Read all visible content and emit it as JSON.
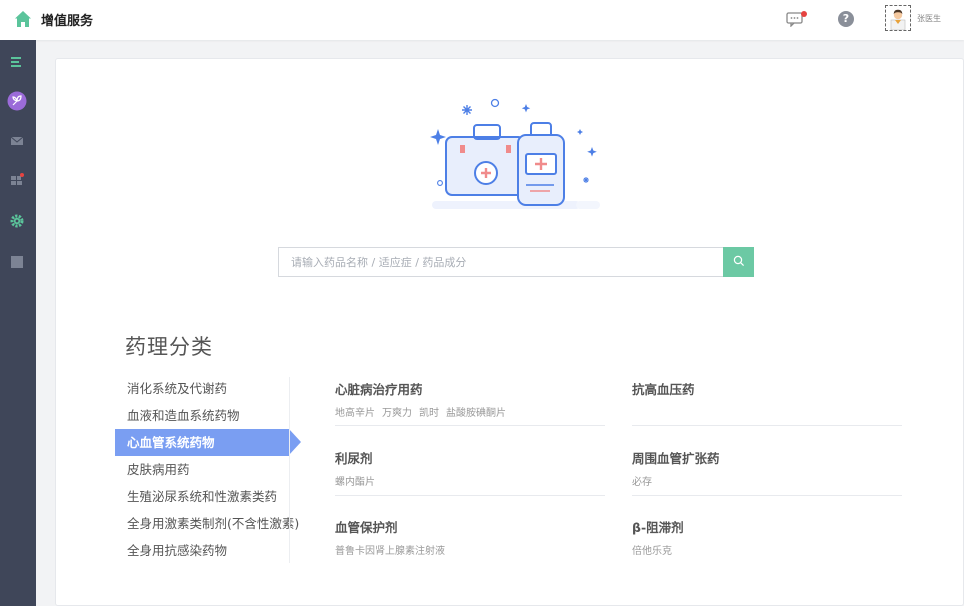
{
  "header": {
    "title": "增值服务",
    "username": "张医生"
  },
  "sidebar": {
    "items": [
      {
        "icon": "menu-icon"
      },
      {
        "icon": "leaf-icon"
      },
      {
        "icon": "mail-icon"
      },
      {
        "icon": "grid-icon"
      },
      {
        "icon": "gear-icon"
      },
      {
        "icon": "square-icon"
      }
    ]
  },
  "search": {
    "placeholder": "请输入药品名称 / 适应症 / 药品成分"
  },
  "section": {
    "title": "药理分类"
  },
  "categories": [
    {
      "label": "消化系统及代谢药"
    },
    {
      "label": "血液和造血系统药物"
    },
    {
      "label": "心血管系统药物",
      "active": true
    },
    {
      "label": "皮肤病用药"
    },
    {
      "label": "生殖泌尿系统和性激素类药"
    },
    {
      "label": "全身用激素类制剂(不含性激素)"
    },
    {
      "label": "全身用抗感染药物"
    }
  ],
  "subcategories": [
    {
      "title": "心脏病治疗用药",
      "drugs": [
        "地高辛片",
        "万爽力",
        "凯时",
        "盐酸胺碘酮片"
      ]
    },
    {
      "title": "抗高血压药",
      "drugs": []
    },
    {
      "title": "利尿剂",
      "drugs": [
        "螺内酯片"
      ]
    },
    {
      "title": "周围血管扩张药",
      "drugs": [
        "必存"
      ]
    },
    {
      "title": "血管保护剂",
      "drugs": [
        "普鲁卡因肾上腺素注射液"
      ]
    },
    {
      "title": "β-阻滞剂",
      "drugs": [
        "倍他乐克"
      ]
    }
  ],
  "colors": {
    "accent": "#6cc9a4",
    "active_category": "#7a9ef2",
    "sidebar_bg": "#3f4659"
  }
}
